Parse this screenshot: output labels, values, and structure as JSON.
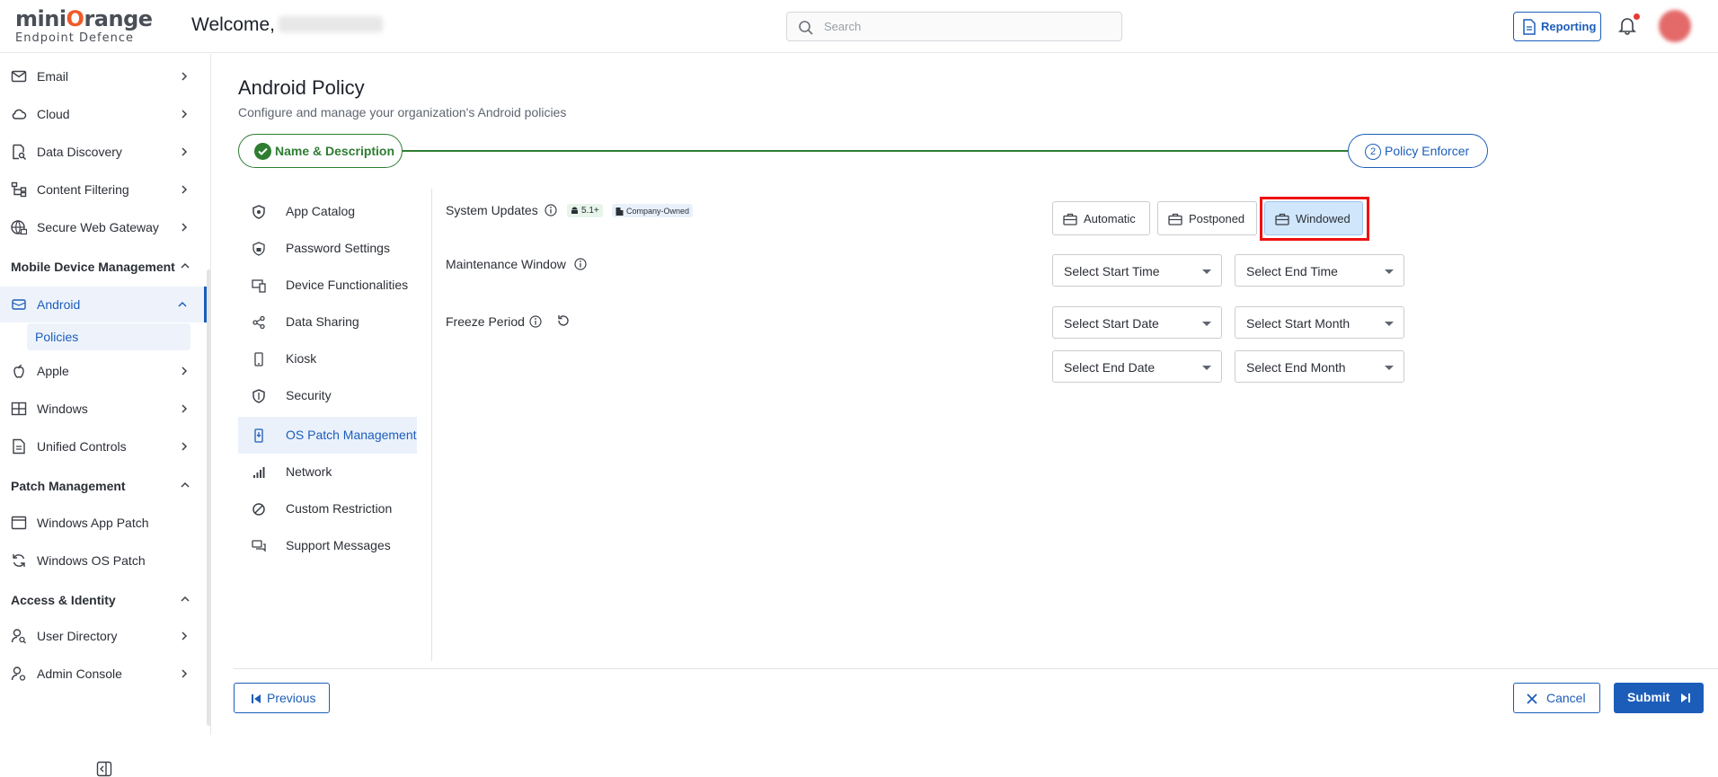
{
  "header": {
    "logo_main_a": "mini",
    "logo_main_o": "O",
    "logo_main_b": "range",
    "logo_sub": "Endpoint Defence",
    "welcome": "Welcome,",
    "search_placeholder": "Search",
    "reporting_label": "Reporting"
  },
  "sidebar": {
    "items": [
      {
        "label": "Email"
      },
      {
        "label": "Cloud"
      },
      {
        "label": "Data Discovery"
      },
      {
        "label": "Content Filtering"
      },
      {
        "label": "Secure Web Gateway"
      }
    ],
    "mdm_section": "Mobile Device Management",
    "android_label": "Android",
    "policies_label": "Policies",
    "mdm_items": [
      {
        "label": "Apple"
      },
      {
        "label": "Windows"
      },
      {
        "label": "Unified Controls"
      }
    ],
    "patch_section": "Patch Management",
    "patch_items": [
      {
        "label": "Windows App Patch"
      },
      {
        "label": "Windows OS Patch"
      }
    ],
    "access_section": "Access & Identity",
    "access_items": [
      {
        "label": "User Directory"
      },
      {
        "label": "Admin Console"
      }
    ]
  },
  "page": {
    "title": "Android Policy",
    "subtitle": "Configure and manage your organization's Android policies"
  },
  "stepper": {
    "step1_label": "Name & Description",
    "step2_number": "2",
    "step2_label": "Policy Enforcer"
  },
  "policy_nav": [
    {
      "label": "App Catalog"
    },
    {
      "label": "Password Settings"
    },
    {
      "label": "Device Functionalities"
    },
    {
      "label": "Data Sharing"
    },
    {
      "label": "Kiosk"
    },
    {
      "label": "Security"
    },
    {
      "label": "OS Patch Management"
    },
    {
      "label": "Network"
    },
    {
      "label": "Custom Restriction"
    },
    {
      "label": "Support Messages"
    }
  ],
  "policy_nav_active": "OS Patch Management",
  "settings": {
    "system_updates_label": "System Updates",
    "android_version_badge": "5.1+",
    "ownership_badge": "Company-Owned",
    "update_options": [
      {
        "label": "Automatic"
      },
      {
        "label": "Postponed"
      },
      {
        "label": "Windowed"
      }
    ],
    "selected_option": "Windowed",
    "maintenance_label": "Maintenance Window",
    "start_time_placeholder": "Select Start Time",
    "end_time_placeholder": "Select End Time",
    "freeze_label": "Freeze Period",
    "start_date_placeholder": "Select Start Date",
    "start_month_placeholder": "Select Start Month",
    "end_date_placeholder": "Select End Date",
    "end_month_placeholder": "Select End Month"
  },
  "footer": {
    "previous_label": "Previous",
    "cancel_label": "Cancel",
    "submit_label": "Submit"
  },
  "colors": {
    "accent": "#1c5dba",
    "success": "#2e7d32",
    "selected_bg": "#cfe6fb",
    "highlight": "#e11111"
  }
}
